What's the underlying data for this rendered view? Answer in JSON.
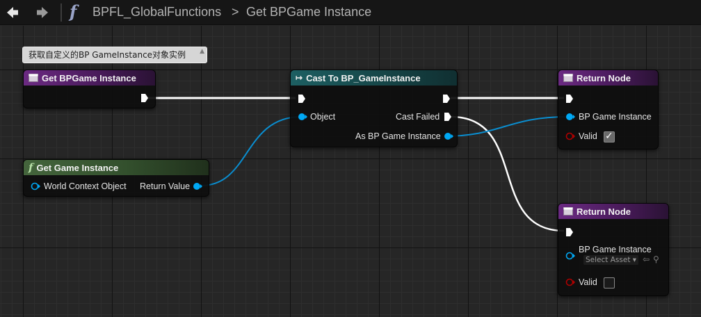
{
  "toolbar": {
    "back_icon": "arrow-left-icon",
    "forward_icon": "arrow-right-icon",
    "function_icon": "function-f-icon",
    "function_glyph": "f",
    "breadcrumb_root": "BPFL_GlobalFunctions",
    "breadcrumb_separator": ">",
    "breadcrumb_current": "Get BPGame Instance"
  },
  "comment": {
    "text": "获取自定义的BP GameInstance对象实例",
    "pin_glyph": "▲"
  },
  "nodes": {
    "entry": {
      "title": "Get BPGame Instance"
    },
    "get_game_instance": {
      "title": "Get Game Instance",
      "icon_glyph": "f",
      "world_context_label": "World Context Object",
      "return_value_label": "Return Value"
    },
    "cast": {
      "title": "Cast To BP_GameInstance",
      "icon_glyph": "↦",
      "object_label": "Object",
      "cast_failed_label": "Cast Failed",
      "as_label": "As BP Game Instance"
    },
    "return_success": {
      "title": "Return Node",
      "bp_label": "BP Game Instance",
      "valid_label": "Valid",
      "valid_checked": true,
      "check_glyph": "✓"
    },
    "return_failed": {
      "title": "Return Node",
      "bp_label": "BP Game Instance",
      "select_asset": "Select Asset",
      "select_arrow": "▾",
      "use_arrow": "⇦",
      "browse_glyph": "⚲",
      "valid_label": "Valid",
      "valid_checked": false
    }
  },
  "colors": {
    "background": "#262626",
    "exec_pin": "#ffffff",
    "object_pin": "#00a8f4",
    "bool_pin": "#940000",
    "header_function_entry": "#6b2a82",
    "header_cast": "#1d5f62",
    "header_pure_function": "#44653c"
  }
}
